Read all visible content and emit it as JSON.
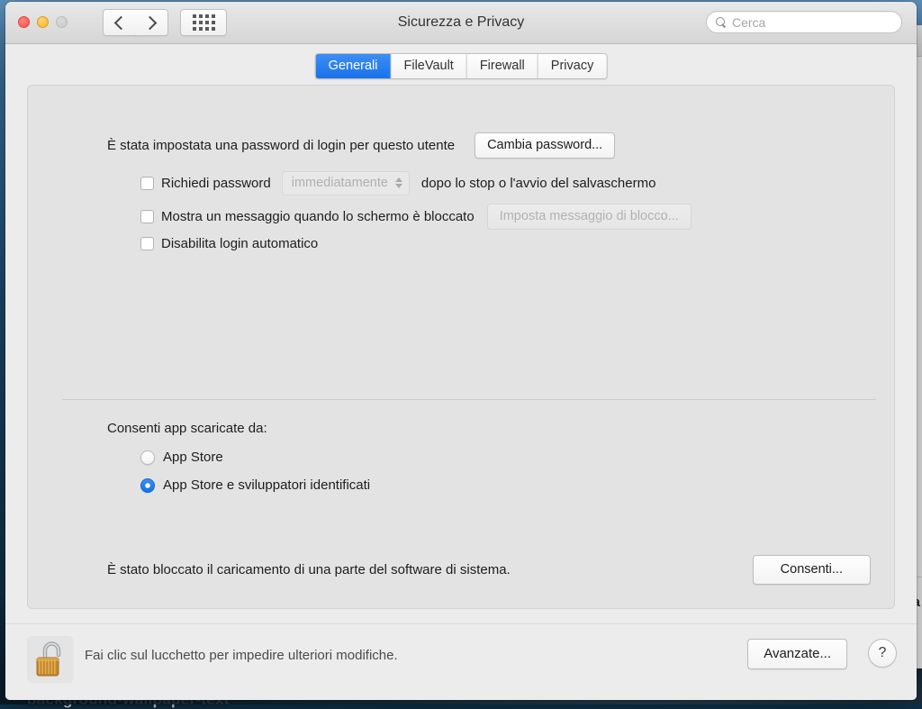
{
  "desktop": {
    "caption": "background-wallpaper-text"
  },
  "background_window": {
    "text_fragment": "ia"
  },
  "titlebar": {
    "title": "Sicurezza e Privacy",
    "back_icon": "chevron-left-icon",
    "forward_icon": "chevron-right-icon",
    "grid_icon": "show-all-grid-icon",
    "search": {
      "placeholder": "Cerca",
      "value": "",
      "icon": "search-icon"
    },
    "traffic_lights": {
      "close": "close-button",
      "minimize": "minimize-button",
      "zoom": "zoom-button"
    }
  },
  "tabs": [
    {
      "label": "Generali",
      "active": true
    },
    {
      "label": "FileVault",
      "active": false
    },
    {
      "label": "Firewall",
      "active": false
    },
    {
      "label": "Privacy",
      "active": false
    }
  ],
  "general": {
    "password_status": "È stata impostata una password di login per questo utente",
    "change_password_button": "Cambia password...",
    "require_password": {
      "label": "Richiedi password",
      "checked": false,
      "popup_value": "immediatamente",
      "popup_enabled": false,
      "suffix": "dopo lo stop o l'avvio del salvaschermo"
    },
    "screen_locked_message": {
      "label": "Mostra un messaggio quando lo schermo è bloccato",
      "checked": false,
      "button": "Imposta messaggio di blocco...",
      "button_enabled": false
    },
    "disable_auto_login": {
      "label": "Disabilita login automatico",
      "checked": false
    },
    "allow_apps": {
      "heading": "Consenti app scaricate da:",
      "options": [
        {
          "label": "App Store",
          "selected": false
        },
        {
          "label": "App Store e sviluppatori identificati",
          "selected": true
        }
      ]
    },
    "blocked_software": {
      "message": "È stato bloccato il caricamento di una parte del software di sistema.",
      "button": "Consenti..."
    }
  },
  "bottom_bar": {
    "lock_icon": "unlocked-padlock-icon",
    "lock_state": "unlocked",
    "lock_message": "Fai clic sul lucchetto per impedire ulteriori modifiche.",
    "advanced_button": "Avanzate...",
    "help_button": "?"
  },
  "colors": {
    "accent_blue": "#1a72e8",
    "window_bg": "#ececec",
    "panel_bg": "#e3e3e3",
    "lock_body": "#d9932f"
  }
}
